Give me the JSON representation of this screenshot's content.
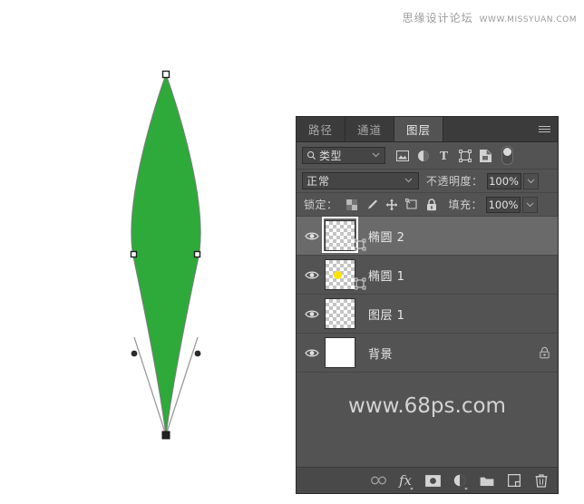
{
  "watermarks": {
    "top_cn": "思缘设计论坛",
    "top_en": "WWW.MISSYUAN.COM",
    "panel": "www.68ps.com"
  },
  "canvas": {
    "shape_name": "leaf-path",
    "fill_color": "#2eaa3a",
    "path_stroke": "#8f8f8f"
  },
  "panel": {
    "tabs": [
      {
        "label": "路径",
        "active": false
      },
      {
        "label": "通道",
        "active": false
      },
      {
        "label": "图层",
        "active": true
      }
    ],
    "menu_icon": "hamburger-menu-icon",
    "filter": {
      "kind_label": "类型",
      "search_icon": "search-icon",
      "icons": [
        "image-filter-icon",
        "adjustment-filter-icon",
        "text-filter-icon",
        "shape-filter-icon",
        "smart-object-filter-icon",
        "filter-toggle-switch"
      ]
    },
    "blend": {
      "mode": "正常",
      "opacity_label": "不透明度：",
      "opacity_value": "100%"
    },
    "lock": {
      "label": "锁定：",
      "icons": [
        "lock-transparent-pixels-icon",
        "lock-image-pixels-icon",
        "lock-position-icon",
        "lock-artboard-icon",
        "lock-all-icon"
      ],
      "fill_label": "填充：",
      "fill_value": "100%"
    },
    "layers": [
      {
        "name": "椭圆 2",
        "visible": true,
        "selected": true,
        "thumb": "transparent",
        "has_vector_mask": true,
        "has_yellow_dot": false,
        "locked": false
      },
      {
        "name": "椭圆 1",
        "visible": true,
        "selected": false,
        "thumb": "transparent",
        "has_vector_mask": true,
        "has_yellow_dot": true,
        "locked": false
      },
      {
        "name": "图层 1",
        "visible": true,
        "selected": false,
        "thumb": "transparent",
        "has_vector_mask": false,
        "has_yellow_dot": false,
        "locked": false
      },
      {
        "name": "背景",
        "visible": true,
        "selected": false,
        "thumb": "white",
        "has_vector_mask": false,
        "has_yellow_dot": false,
        "locked": true
      }
    ],
    "bottom_toolbar": [
      "link-layers-icon",
      "layer-style-fx-icon",
      "layer-mask-icon",
      "adjustment-layer-icon",
      "new-group-icon",
      "new-layer-icon",
      "delete-layer-icon"
    ]
  }
}
